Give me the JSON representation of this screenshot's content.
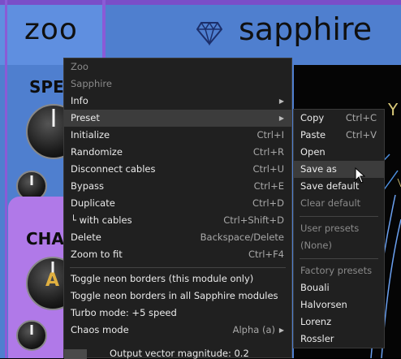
{
  "header": {
    "zoo_title": "zoo",
    "sapphire_title": "sapphire",
    "speed_label": "SPEE",
    "chaos_label": "CHAO",
    "chaos_knob_letter": "A",
    "screen_letter": "Y"
  },
  "main_menu": {
    "items": [
      {
        "label": "Zoo",
        "shortcut": ""
      },
      {
        "label": "Sapphire",
        "shortcut": ""
      },
      {
        "label": "Info",
        "shortcut": ""
      },
      {
        "label": "Preset",
        "shortcut": ""
      },
      {
        "label": "Initialize",
        "shortcut": "Ctrl+I"
      },
      {
        "label": "Randomize",
        "shortcut": "Ctrl+R"
      },
      {
        "label": "Disconnect cables",
        "shortcut": "Ctrl+U"
      },
      {
        "label": "Bypass",
        "shortcut": "Ctrl+E"
      },
      {
        "label": "Duplicate",
        "shortcut": "Ctrl+D"
      },
      {
        "label": "└ with cables",
        "shortcut": "Ctrl+Shift+D"
      },
      {
        "label": "Delete",
        "shortcut": "Backspace/Delete"
      },
      {
        "label": "Zoom to fit",
        "shortcut": "Ctrl+F4"
      },
      {
        "label": "Toggle neon borders (this module only)",
        "shortcut": ""
      },
      {
        "label": "Toggle neon borders in all Sapphire modules",
        "shortcut": ""
      },
      {
        "label": "Turbo mode: +5 speed",
        "shortcut": ""
      },
      {
        "label": "Chaos mode",
        "shortcut": "Alpha (a)"
      },
      {
        "label": "Output vector magnitude: 0.2",
        "shortcut": ""
      }
    ]
  },
  "preset_menu": {
    "items": [
      {
        "label": "Copy",
        "shortcut": "Ctrl+C"
      },
      {
        "label": "Paste",
        "shortcut": "Ctrl+V"
      },
      {
        "label": "Open",
        "shortcut": ""
      },
      {
        "label": "Save as",
        "shortcut": ""
      },
      {
        "label": "Save default",
        "shortcut": ""
      },
      {
        "label": "Clear default",
        "shortcut": ""
      },
      {
        "label": "User presets",
        "shortcut": ""
      },
      {
        "label": "(None)",
        "shortcut": ""
      },
      {
        "label": "Factory presets",
        "shortcut": ""
      },
      {
        "label": "Bouali",
        "shortcut": ""
      },
      {
        "label": "Halvorsen",
        "shortcut": ""
      },
      {
        "label": "Lorenz",
        "shortcut": ""
      },
      {
        "label": "Rossler",
        "shortcut": ""
      }
    ]
  },
  "colors": {
    "panel_blue": "#4f7fcf",
    "header_purple": "#8a5bd6",
    "menu_bg": "#202020",
    "highlight": "#3c3c3c"
  }
}
